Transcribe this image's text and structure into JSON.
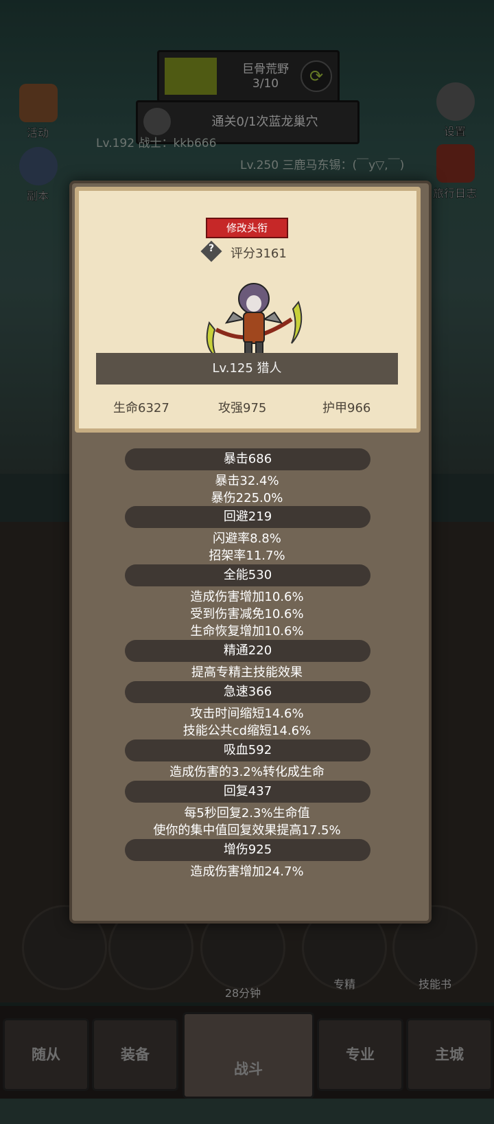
{
  "background": {
    "zone": {
      "name": "巨骨荒野",
      "progress": "3/10"
    },
    "quest": "通关0/1次蓝龙巢穴",
    "left_buttons": [
      {
        "label": "活动"
      },
      {
        "label": "副本"
      }
    ],
    "right_buttons": [
      {
        "label": "设置"
      },
      {
        "label": "旅行日志"
      }
    ],
    "chat": [
      "Lv.192 战士：kkb666",
      "Lv.250 三鹿马东锡：(￣y▽,￣)"
    ],
    "action_bar": [
      {
        "label": ""
      },
      {
        "label": ""
      },
      {
        "label": "28分钟"
      },
      {
        "label": "专精"
      },
      {
        "label": "技能书"
      }
    ],
    "tabs": [
      "随从",
      "装备",
      "战斗",
      "专业",
      "主城"
    ]
  },
  "profile": {
    "edit_title_label": "修改头衔",
    "score_label": "评分3161",
    "level_class": "Lv.125 猎人",
    "base_stats": {
      "hp": "生命6327",
      "attack": "攻强975",
      "armor": "护甲966"
    }
  },
  "stats": [
    {
      "header": "暴击686",
      "lines": [
        "暴击32.4%",
        "暴伤225.0%"
      ]
    },
    {
      "header": "回避219",
      "lines": [
        "闪避率8.8%",
        "招架率11.7%"
      ]
    },
    {
      "header": "全能530",
      "lines": [
        "造成伤害增加10.6%",
        "受到伤害减免10.6%",
        "生命恢复增加10.6%"
      ]
    },
    {
      "header": "精通220",
      "lines": [
        "提高专精主技能效果"
      ]
    },
    {
      "header": "急速366",
      "lines": [
        "攻击时间缩短14.6%",
        "技能公共cd缩短14.6%"
      ]
    },
    {
      "header": "吸血592",
      "lines": [
        "造成伤害的3.2%转化成生命"
      ]
    },
    {
      "header": "回复437",
      "lines": [
        "每5秒回复2.3%生命值",
        "使你的集中值回复效果提高17.5%"
      ]
    },
    {
      "header": "增伤925",
      "lines": [
        "造成伤害增加24.7%"
      ]
    }
  ]
}
